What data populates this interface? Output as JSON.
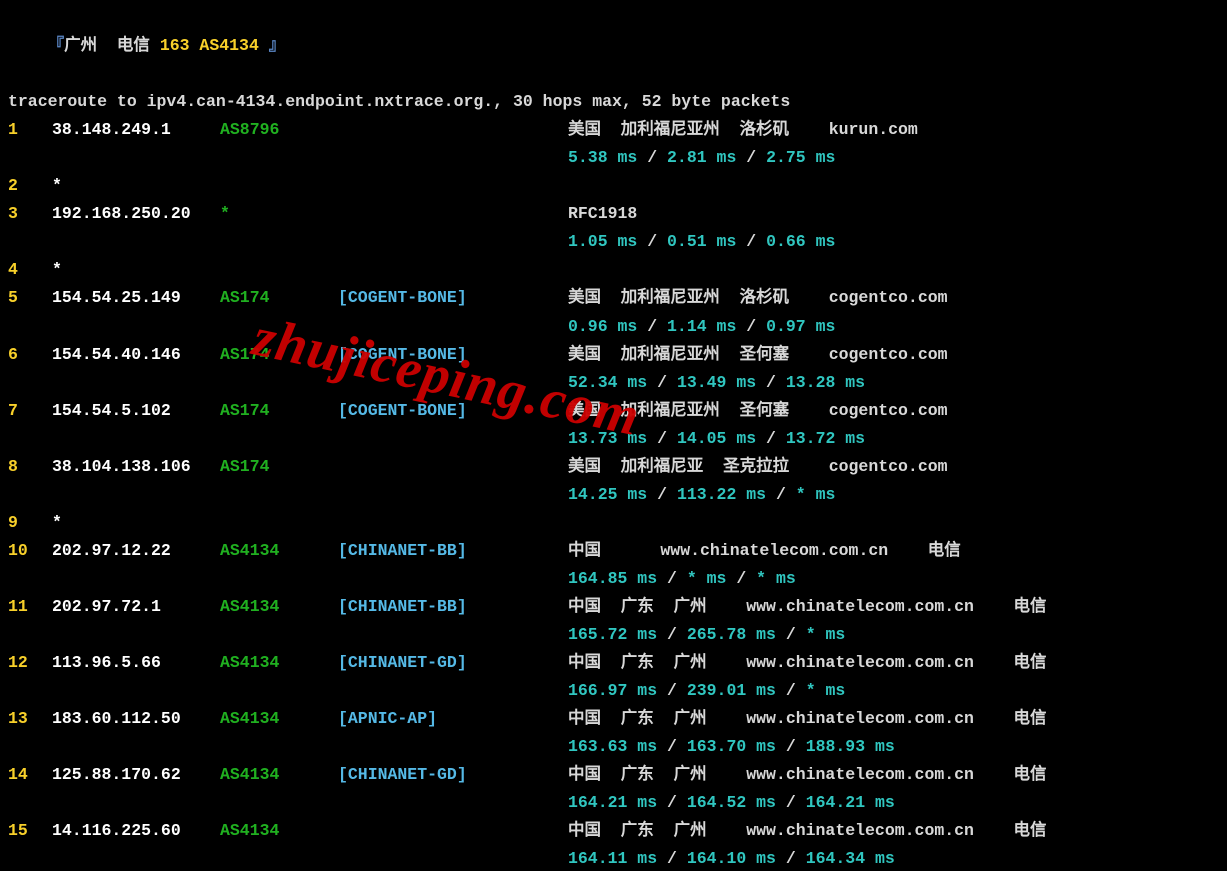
{
  "title": {
    "open_bracket": "『",
    "location": "广州  电信 ",
    "asn": "163 AS4134",
    "close_bracket": " 』"
  },
  "cmdline": "traceroute to ipv4.can-4134.endpoint.nxtrace.org., 30 hops max, 52 byte packets",
  "watermark": "zhujiceping.com",
  "hops": [
    {
      "num": "1",
      "ip": "38.148.249.1",
      "as": "AS8796",
      "tag": "",
      "loc": "美国  加利福尼亚州  洛杉矶    kurun.com",
      "ping": [
        "5.38 ms",
        "2.81 ms",
        "2.75 ms"
      ]
    },
    {
      "num": "2",
      "ip": "*",
      "as": "",
      "tag": "",
      "loc": "",
      "ping": null
    },
    {
      "num": "3",
      "ip": "192.168.250.20",
      "as": "*",
      "tag": "",
      "loc": "RFC1918",
      "ping": [
        "1.05 ms",
        "0.51 ms",
        "0.66 ms"
      ]
    },
    {
      "num": "4",
      "ip": "*",
      "as": "",
      "tag": "",
      "loc": "",
      "ping": null
    },
    {
      "num": "5",
      "ip": "154.54.25.149",
      "as": "AS174",
      "tag": "[COGENT-BONE]",
      "loc": "美国  加利福尼亚州  洛杉矶    cogentco.com",
      "ping": [
        "0.96 ms",
        "1.14 ms",
        "0.97 ms"
      ]
    },
    {
      "num": "6",
      "ip": "154.54.40.146",
      "as": "AS174",
      "tag": "[COGENT-BONE]",
      "loc": "美国  加利福尼亚州  圣何塞    cogentco.com",
      "ping": [
        "52.34 ms",
        "13.49 ms",
        "13.28 ms"
      ]
    },
    {
      "num": "7",
      "ip": "154.54.5.102",
      "as": "AS174",
      "tag": "[COGENT-BONE]",
      "loc": "美国  加利福尼亚州  圣何塞    cogentco.com",
      "ping": [
        "13.73 ms",
        "14.05 ms",
        "13.72 ms"
      ]
    },
    {
      "num": "8",
      "ip": "38.104.138.106",
      "as": "AS174",
      "tag": "",
      "loc": "美国  加利福尼亚  圣克拉拉    cogentco.com",
      "ping": [
        "14.25 ms",
        "113.22 ms",
        "* ms"
      ]
    },
    {
      "num": "9",
      "ip": "*",
      "as": "",
      "tag": "",
      "loc": "",
      "ping": null
    },
    {
      "num": "10",
      "ip": "202.97.12.22",
      "as": "AS4134",
      "tag": "[CHINANET-BB]",
      "loc": "中国      www.chinatelecom.com.cn    电信",
      "ping": [
        "164.85 ms",
        "* ms",
        "* ms"
      ]
    },
    {
      "num": "11",
      "ip": "202.97.72.1",
      "as": "AS4134",
      "tag": "[CHINANET-BB]",
      "loc": "中国  广东  广州    www.chinatelecom.com.cn    电信",
      "ping": [
        "165.72 ms",
        "265.78 ms",
        "* ms"
      ]
    },
    {
      "num": "12",
      "ip": "113.96.5.66",
      "as": "AS4134",
      "tag": "[CHINANET-GD]",
      "loc": "中国  广东  广州    www.chinatelecom.com.cn    电信",
      "ping": [
        "166.97 ms",
        "239.01 ms",
        "* ms"
      ]
    },
    {
      "num": "13",
      "ip": "183.60.112.50",
      "as": "AS4134",
      "tag": "[APNIC-AP]",
      "loc": "中国  广东  广州    www.chinatelecom.com.cn    电信",
      "ping": [
        "163.63 ms",
        "163.70 ms",
        "188.93 ms"
      ]
    },
    {
      "num": "14",
      "ip": "125.88.170.62",
      "as": "AS4134",
      "tag": "[CHINANET-GD]",
      "loc": "中国  广东  广州    www.chinatelecom.com.cn    电信",
      "ping": [
        "164.21 ms",
        "164.52 ms",
        "164.21 ms"
      ]
    },
    {
      "num": "15",
      "ip": "14.116.225.60",
      "as": "AS4134",
      "tag": "",
      "loc": "中国  广东  广州    www.chinatelecom.com.cn    电信",
      "ping": [
        "164.11 ms",
        "164.10 ms",
        "164.34 ms"
      ]
    }
  ]
}
